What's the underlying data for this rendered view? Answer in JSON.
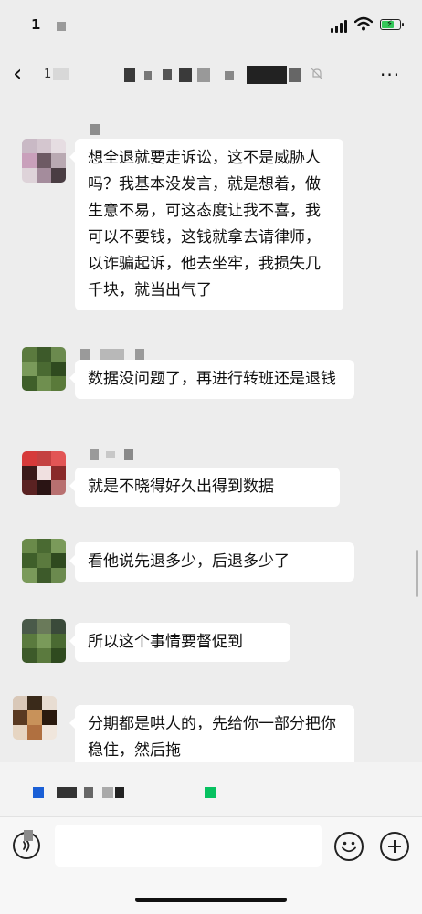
{
  "status_bar": {
    "time": "1"
  },
  "nav": {
    "back_glyph": "‹",
    "back_count": "1",
    "more_glyph": "···"
  },
  "messages": [
    {
      "text": "想全退就要走诉讼，这不是威胁人吗？我基本没发言，就是想着，做生意不易，可这态度让我不喜，我可以不要钱，这钱就拿去请律师，以诈骗起诉，他去坐牢，我损失几千块，就当出气了"
    },
    {
      "text": "数据没问题了，再进行转班还是退钱"
    },
    {
      "text": "就是不晓得好久出得到数据"
    },
    {
      "text": "看他说先退多少，后退多少了"
    },
    {
      "text": "所以这个事情要督促到"
    },
    {
      "text": "分期都是哄人的，先给你一部分把你稳住，然后拖"
    }
  ],
  "icons": {
    "back": "chevron-left-icon",
    "more": "more-dots-icon",
    "mute": "mute-bell-icon",
    "voice": "voice-icon",
    "emoji": "emoji-icon",
    "plus": "plus-icon"
  },
  "colors": {
    "chat_background": "#ededed",
    "bubble": "#ffffff",
    "battery": "#34c759",
    "accent_green": "#07c160",
    "accent_blue": "#1a5fd6"
  }
}
